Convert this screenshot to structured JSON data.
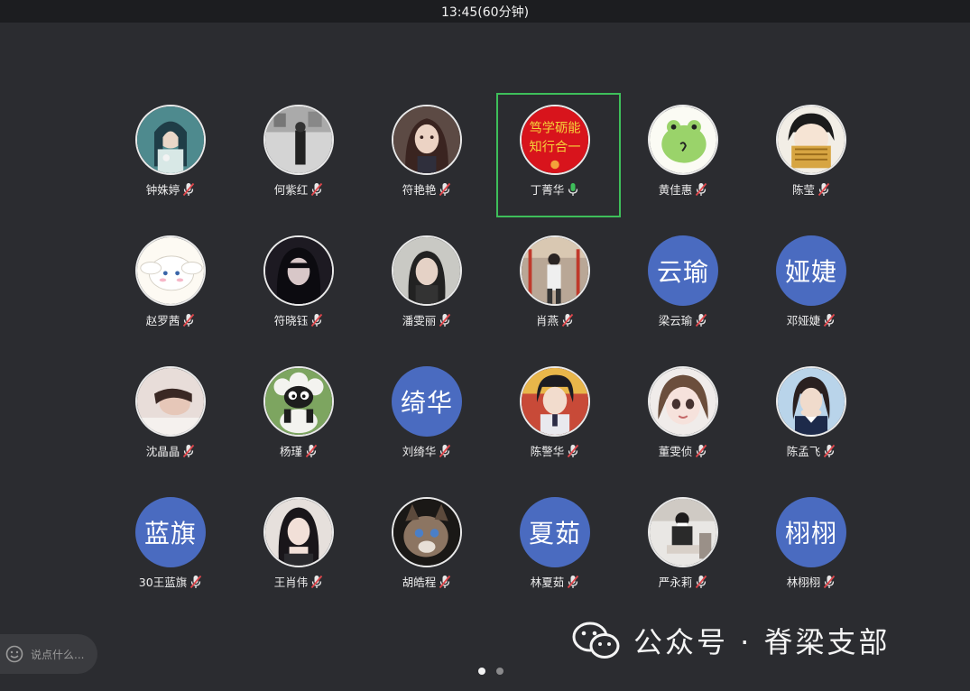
{
  "header": {
    "time": "13:45(60分钟)"
  },
  "participants": [
    {
      "name": "钟姝婷",
      "avatar": "photo-anime-girl",
      "mic": "muted"
    },
    {
      "name": "何紫红",
      "avatar": "photo-bw-street",
      "mic": "muted"
    },
    {
      "name": "符艳艳",
      "avatar": "photo-anime-portrait",
      "mic": "muted"
    },
    {
      "name": "丁菁华",
      "avatar": "calligraphy-red",
      "avatar_text_line1": "笃学砺能",
      "avatar_text_line2": "知行合一",
      "mic": "active",
      "speaking": true
    },
    {
      "name": "黄佳惠",
      "avatar": "frog-sticker",
      "mic": "muted"
    },
    {
      "name": "陈莹",
      "avatar": "anime-noodles",
      "mic": "muted"
    },
    {
      "name": "赵罗茜",
      "avatar": "cinnamoroll",
      "mic": "muted"
    },
    {
      "name": "符晓钰",
      "avatar": "photo-dark-hair",
      "mic": "muted"
    },
    {
      "name": "潘雯丽",
      "avatar": "photo-portrait",
      "mic": "muted"
    },
    {
      "name": "肖燕",
      "avatar": "photo-playground",
      "mic": "muted"
    },
    {
      "name": "梁云瑜",
      "avatar_text": "云瑜",
      "mic": "muted"
    },
    {
      "name": "邓娅婕",
      "avatar_text": "娅婕",
      "mic": "muted"
    },
    {
      "name": "沈晶晶",
      "avatar": "photo-lying",
      "mic": "muted"
    },
    {
      "name": "杨瑾",
      "avatar": "shaun-sheep",
      "mic": "muted"
    },
    {
      "name": "刘绮华",
      "avatar_text": "绮华",
      "mic": "muted"
    },
    {
      "name": "陈警华",
      "avatar": "anime-boy",
      "mic": "muted"
    },
    {
      "name": "董雯侦",
      "avatar": "doll-face",
      "mic": "muted"
    },
    {
      "name": "陈孟飞",
      "avatar": "photo-girl-hands",
      "mic": "muted"
    },
    {
      "name": "30王蓝旗",
      "avatar_text": "蓝旗",
      "mic": "muted"
    },
    {
      "name": "王肖伟",
      "avatar": "photo-long-hair",
      "mic": "muted"
    },
    {
      "name": "胡皓程",
      "avatar": "photo-cat",
      "mic": "muted"
    },
    {
      "name": "林夏茹",
      "avatar_text": "夏茹",
      "mic": "muted"
    },
    {
      "name": "严永莉",
      "avatar": "photo-sitting",
      "mic": "muted"
    },
    {
      "name": "林栩栩",
      "avatar_text": "栩栩",
      "mic": "muted"
    }
  ],
  "chat": {
    "placeholder": "说点什么..."
  },
  "pagination": {
    "current": 1,
    "total": 2
  },
  "watermark": {
    "text": "公众号 · 脊梁支部"
  },
  "colors": {
    "background": "#2b2c30",
    "text_avatar": "#4a6bc0",
    "speaking_border": "#3ebf5a",
    "mic_muted": "#e0474c",
    "mic_active": "#3ebf5a"
  }
}
